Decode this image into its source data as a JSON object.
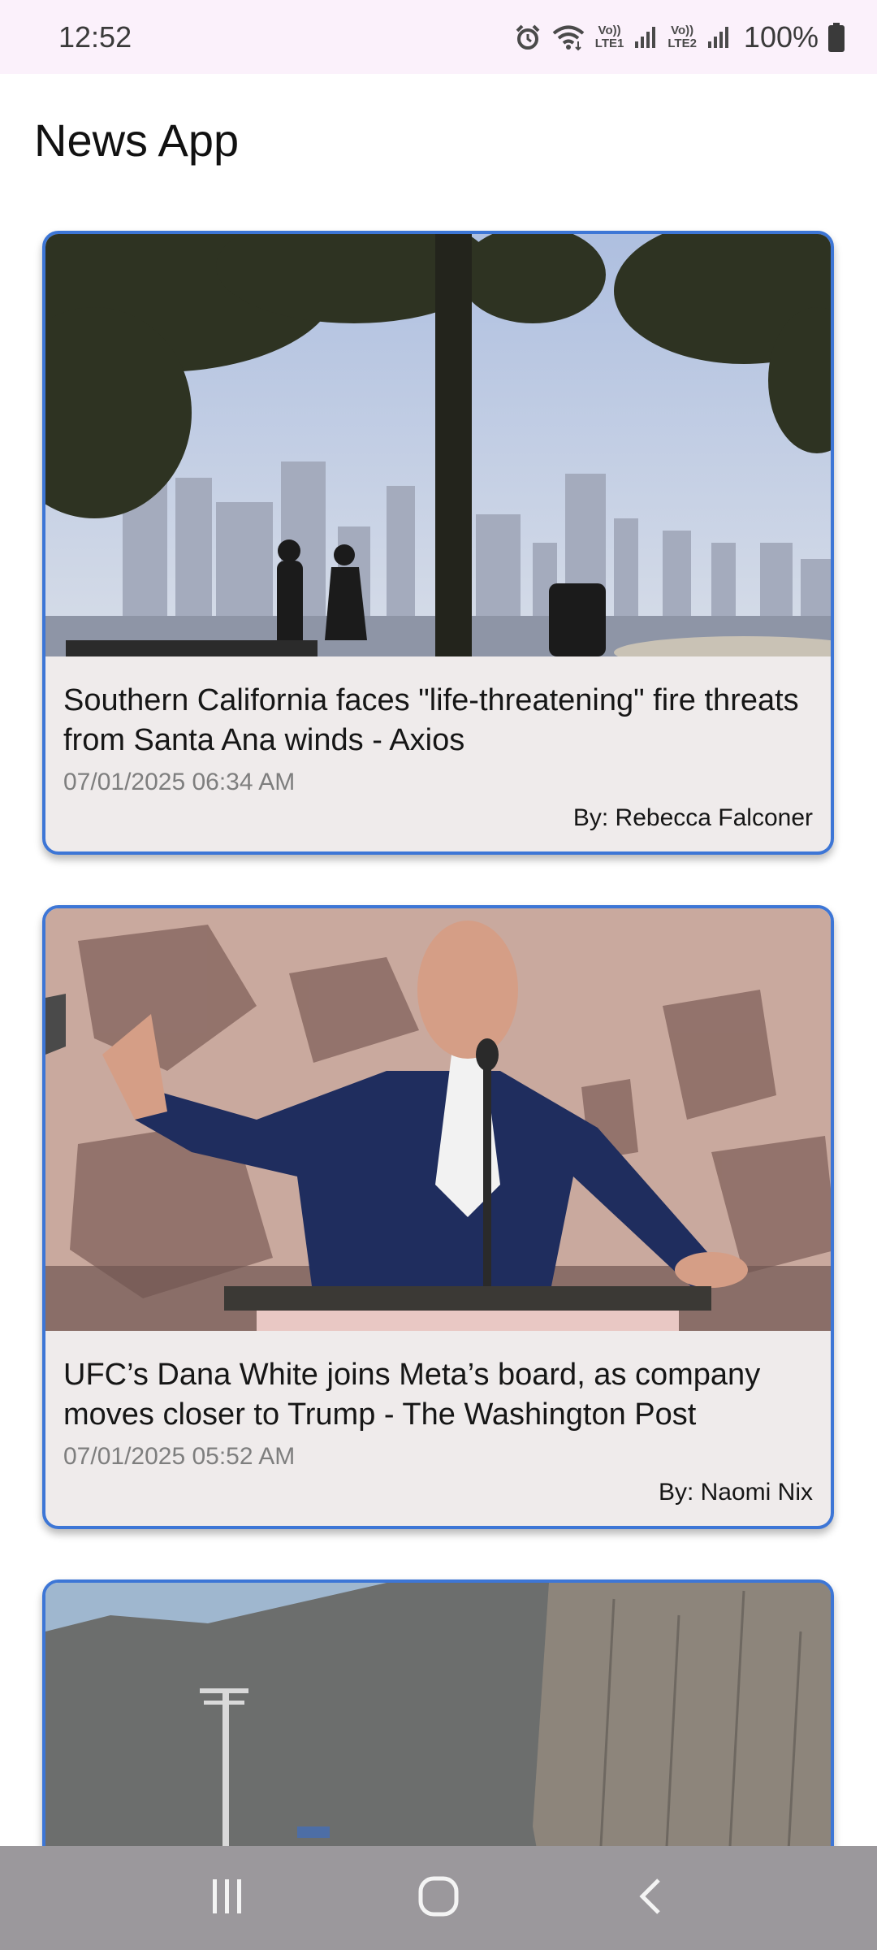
{
  "status_bar": {
    "time": "12:52",
    "battery": "100%",
    "sim1_label_top": "Vo))",
    "sim1_label_bottom": "LTE1",
    "sim2_label_top": "Vo))",
    "sim2_label_bottom": "LTE2",
    "icons": [
      "alarm-icon",
      "wifi-icon",
      "signal-icon",
      "signal-icon",
      "battery-icon"
    ]
  },
  "app": {
    "title": "News App"
  },
  "articles": [
    {
      "title": "Southern California faces \"life-threatening\" fire threats from Santa Ana winds - Axios",
      "date": "07/01/2025 06:34 AM",
      "author": "By: Rebecca Falconer",
      "image_desc": "city skyline silhouette with trees"
    },
    {
      "title": "UFC’s Dana White joins Meta’s board, as company moves closer to Trump - The Washington Post",
      "date": "07/01/2025 05:52 AM",
      "author": "By: Naomi Nix",
      "image_desc": "man speaking at podium"
    },
    {
      "title": "",
      "date": "",
      "author": "",
      "image_desc": "rocky hillside with power pole"
    }
  ],
  "nav": {
    "recents": "recents-icon",
    "home": "home-icon",
    "back": "back-icon"
  },
  "colors": {
    "accent": "#3d76d6",
    "card_bg": "#efebeb",
    "status_bg": "#fbf1fb",
    "nav_bg": "#9b989c"
  }
}
